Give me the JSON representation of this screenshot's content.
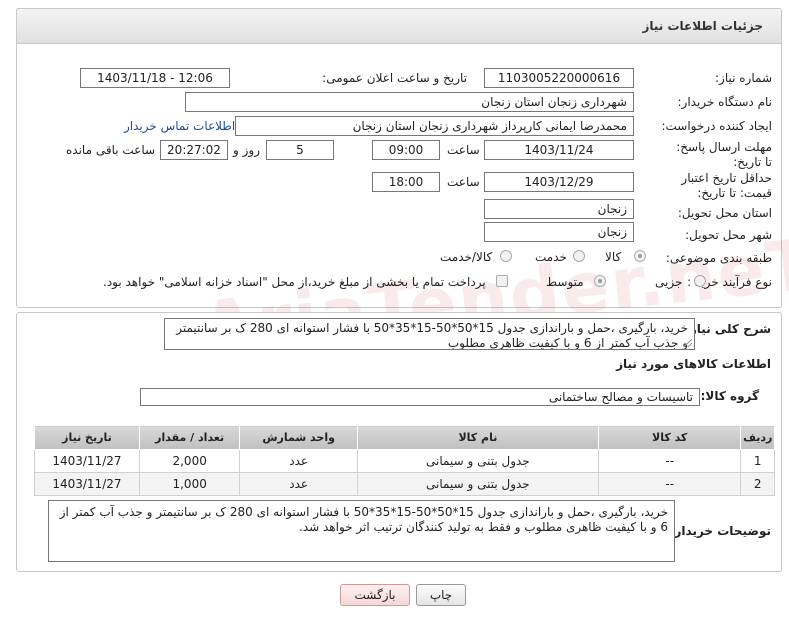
{
  "header": {
    "title": "جزئیات اطلاعات نیاز"
  },
  "form": {
    "need_number": {
      "label": "شماره نیاز:",
      "value": "1103005220000616"
    },
    "announce": {
      "label": "تاریخ و ساعت اعلان عمومی:",
      "value": "1403/11/18 - 12:06"
    },
    "buyer_org": {
      "label": "نام دستگاه خریدار:",
      "value": "شهرداری زنجان استان زنجان"
    },
    "creator": {
      "label": "ایجاد کننده درخواست:",
      "value": "محمدرضا  ایمانی کارپرداز شهرداری زنجان استان زنجان",
      "contact_link": "اطلاعات تماس خریدار"
    },
    "deadline": {
      "label": "مهلت ارسال پاسخ: تا تاریخ:",
      "date": "1403/11/24",
      "time_label": "ساعت",
      "time": "09:00",
      "days": "5",
      "days_label": "روز و",
      "remaining": "20:27:02",
      "remaining_label": "ساعت باقی مانده"
    },
    "validity": {
      "label": "حداقل تاریخ اعتبار قیمت: تا تاریخ:",
      "date": "1403/12/29",
      "time_label": "ساعت",
      "time": "18:00"
    },
    "province": {
      "label": "استان محل تحویل:",
      "value": "زنجان"
    },
    "city": {
      "label": "شهر محل تحویل:",
      "value": "زنجان"
    },
    "category": {
      "label": "طبقه بندی موضوعی:",
      "options": [
        "کالا",
        "خدمت",
        "کالا/خدمت"
      ],
      "selected": "کالا"
    },
    "process": {
      "label": "نوع فرآیند خرید :",
      "options": [
        "جزیی",
        "متوسط"
      ],
      "selected": "متوسط",
      "payment_note": "پرداخت تمام یا بخشی از مبلغ خرید،از محل \"اسناد خزانه اسلامی\" خواهد بود."
    }
  },
  "summary": {
    "label": "شرح کلی نیاز:",
    "text": "خرید، بارگیری ،حمل و باراندازی جدول 15*50*50-15*35*50 با فشار استوانه ای 280 ک بر سانتیمتر و جذب آب کمتر از 6 و با کیفیت ظاهری مطلوب"
  },
  "goods": {
    "section_title": "اطلاعات کالاهای مورد نیاز",
    "group_label": "گروه کالا:",
    "group_value": "تاسیسات و مصالح ساختمانی",
    "columns": [
      "ردیف",
      "کد کالا",
      "نام کالا",
      "واحد شمارش",
      "تعداد / مقدار",
      "تاریخ نیاز"
    ],
    "rows": [
      [
        "1",
        "--",
        "جدول بتنی و سیمانی",
        "عدد",
        "2,000",
        "1403/11/27"
      ],
      [
        "2",
        "--",
        "جدول بتنی و سیمانی",
        "عدد",
        "1,000",
        "1403/11/27"
      ]
    ]
  },
  "buyer_notes": {
    "label": "توضیحات خریدار:",
    "text": "خرید، بارگیری ،حمل و باراندازی جدول 15*50*50-15*35*50 با فشار استوانه ای 280 ک بر سانتیمتر و جذب آب کمتر از 6 و با کیفیت ظاهری مطلوب و فقط به تولید کنندگان ترتیب اثر خواهد شد."
  },
  "buttons": {
    "print": "چاپ",
    "back": "بازگشت"
  },
  "watermark": "AriaTender.neT"
}
